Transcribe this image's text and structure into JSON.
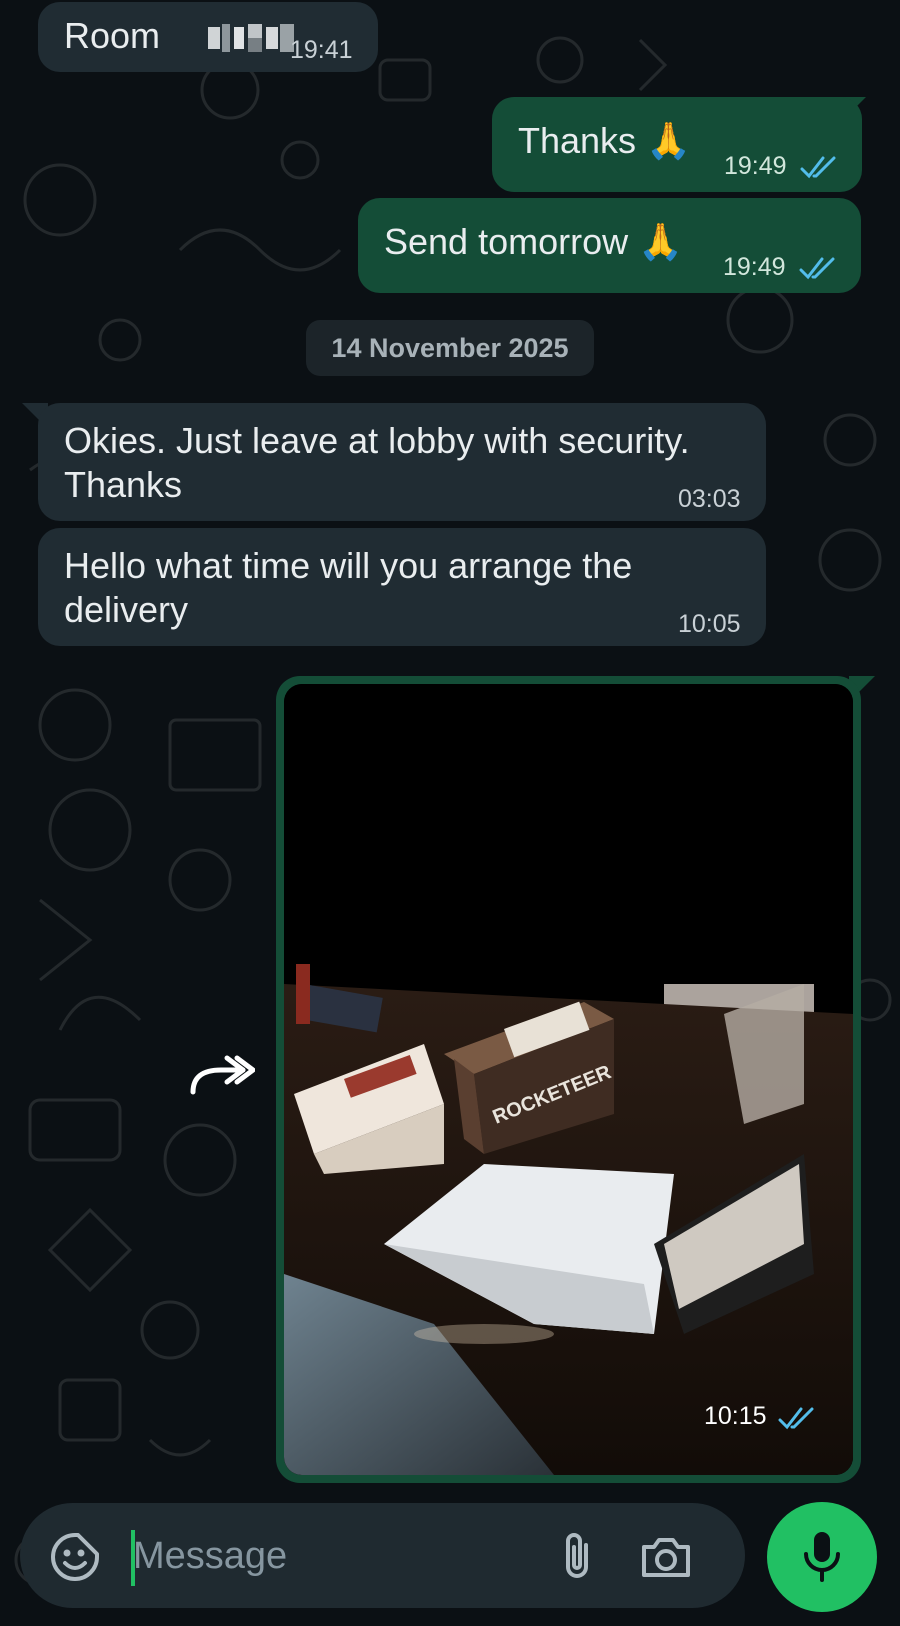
{
  "messages": [
    {
      "text": "Room ",
      "time": "19:41",
      "direction": "in"
    },
    {
      "text": "Thanks 🙏",
      "time": "19:49",
      "direction": "out",
      "status": "read"
    },
    {
      "text": "Send tomorrow 🙏",
      "time": "19:49",
      "direction": "out",
      "status": "read"
    }
  ],
  "date_separator": "14 November 2025",
  "messages_today": [
    {
      "text": "Okies. Just leave at lobby with security.\nThanks",
      "time": "03:03",
      "direction": "in"
    },
    {
      "text": "Hello what time will you arrange the\ndelivery",
      "time": "10:05",
      "direction": "in"
    },
    {
      "type": "image",
      "time": "10:15",
      "direction": "out",
      "status": "read",
      "caption_on_box": "ROCKETEER"
    }
  ],
  "composer": {
    "placeholder": "Message"
  },
  "icons": {
    "emoji": "sticker-smiley-icon",
    "attach": "paperclip-icon",
    "camera": "camera-icon",
    "mic": "microphone-icon",
    "forward": "forward-arrow-icon",
    "read": "double-check-icon"
  },
  "colors": {
    "background": "#0b1014",
    "incoming_bubble": "#202c33",
    "outgoing_bubble": "#144d37",
    "accent_green": "#21c063",
    "read_tick": "#53bdeb"
  }
}
